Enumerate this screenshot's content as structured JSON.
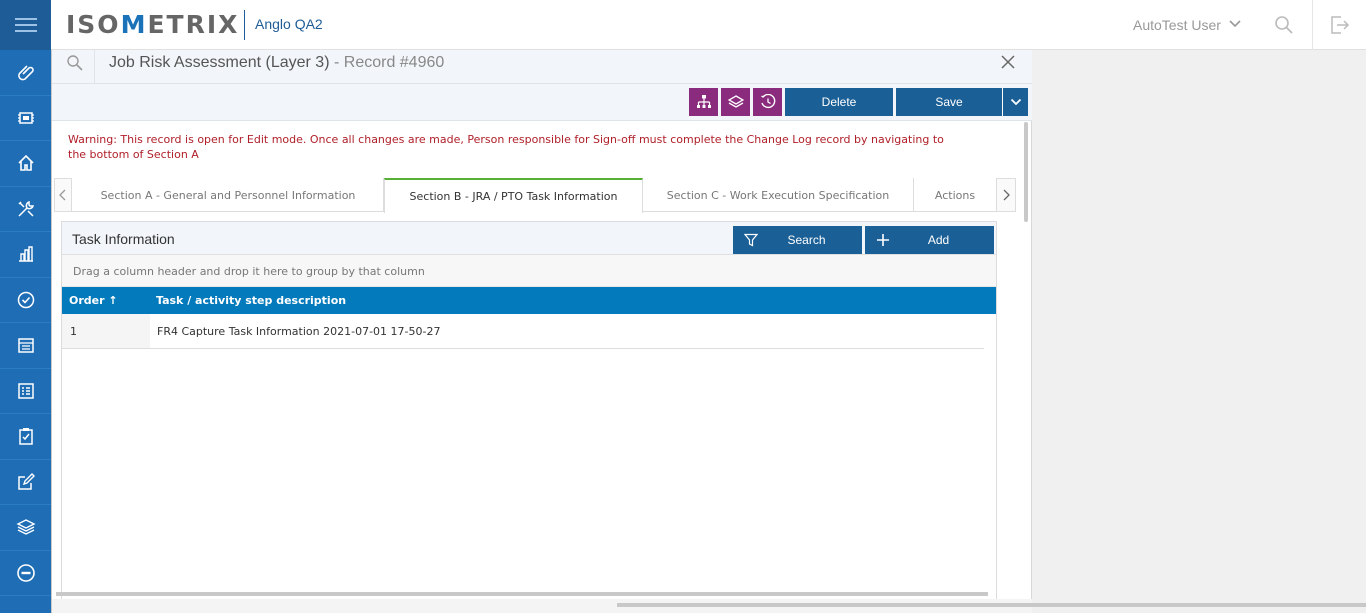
{
  "header": {
    "logo_left": "ISO",
    "logo_accent": "M",
    "logo_right": "ETRIX",
    "tenant": "Anglo QA2",
    "user_name": "AutoTest User"
  },
  "sidebar": {
    "items": [
      {
        "icon": "paperclip-icon"
      },
      {
        "icon": "chip-icon"
      },
      {
        "icon": "home-icon"
      },
      {
        "icon": "tools-icon"
      },
      {
        "icon": "bar-chart-icon"
      },
      {
        "icon": "check-circle-icon"
      },
      {
        "icon": "calendar-icon"
      },
      {
        "icon": "list-icon"
      },
      {
        "icon": "clipboard-check-icon"
      },
      {
        "icon": "edit-icon"
      },
      {
        "icon": "layers-icon"
      },
      {
        "icon": "minus-circle-icon"
      }
    ]
  },
  "record": {
    "title": "Job Risk Assessment (Layer 3)",
    "record_label": "- Record #4960"
  },
  "toolbar": {
    "delete_label": "Delete",
    "save_label": "Save"
  },
  "warning": "Warning: This record is open for Edit mode. Once all changes are made, Person responsible for Sign-off must complete the Change Log record by navigating to the bottom of Section A",
  "tabs": [
    {
      "label": "Section A - General and Personnel Information"
    },
    {
      "label": "Section B - JRA / PTO Task Information",
      "active": true
    },
    {
      "label": "Section C - Work Execution Specification"
    },
    {
      "label": "Actions"
    }
  ],
  "grid": {
    "title": "Task Information",
    "search_label": "Search",
    "add_label": "Add",
    "group_hint": "Drag a column header and drop it here to group by that column",
    "columns": [
      "Order ↑",
      "Task / activity step description"
    ],
    "rows": [
      {
        "order": "1",
        "description": "FR4 Capture Task Information 2021-07-01 17-50-27"
      }
    ]
  },
  "colors": {
    "brand_blue": "#1e6db5",
    "button_blue": "#1a5f96",
    "grid_header": "#027abb",
    "icon_button_purple": "#8b2b7e",
    "warning_red": "#b0202a",
    "active_tab": "#55b035"
  }
}
